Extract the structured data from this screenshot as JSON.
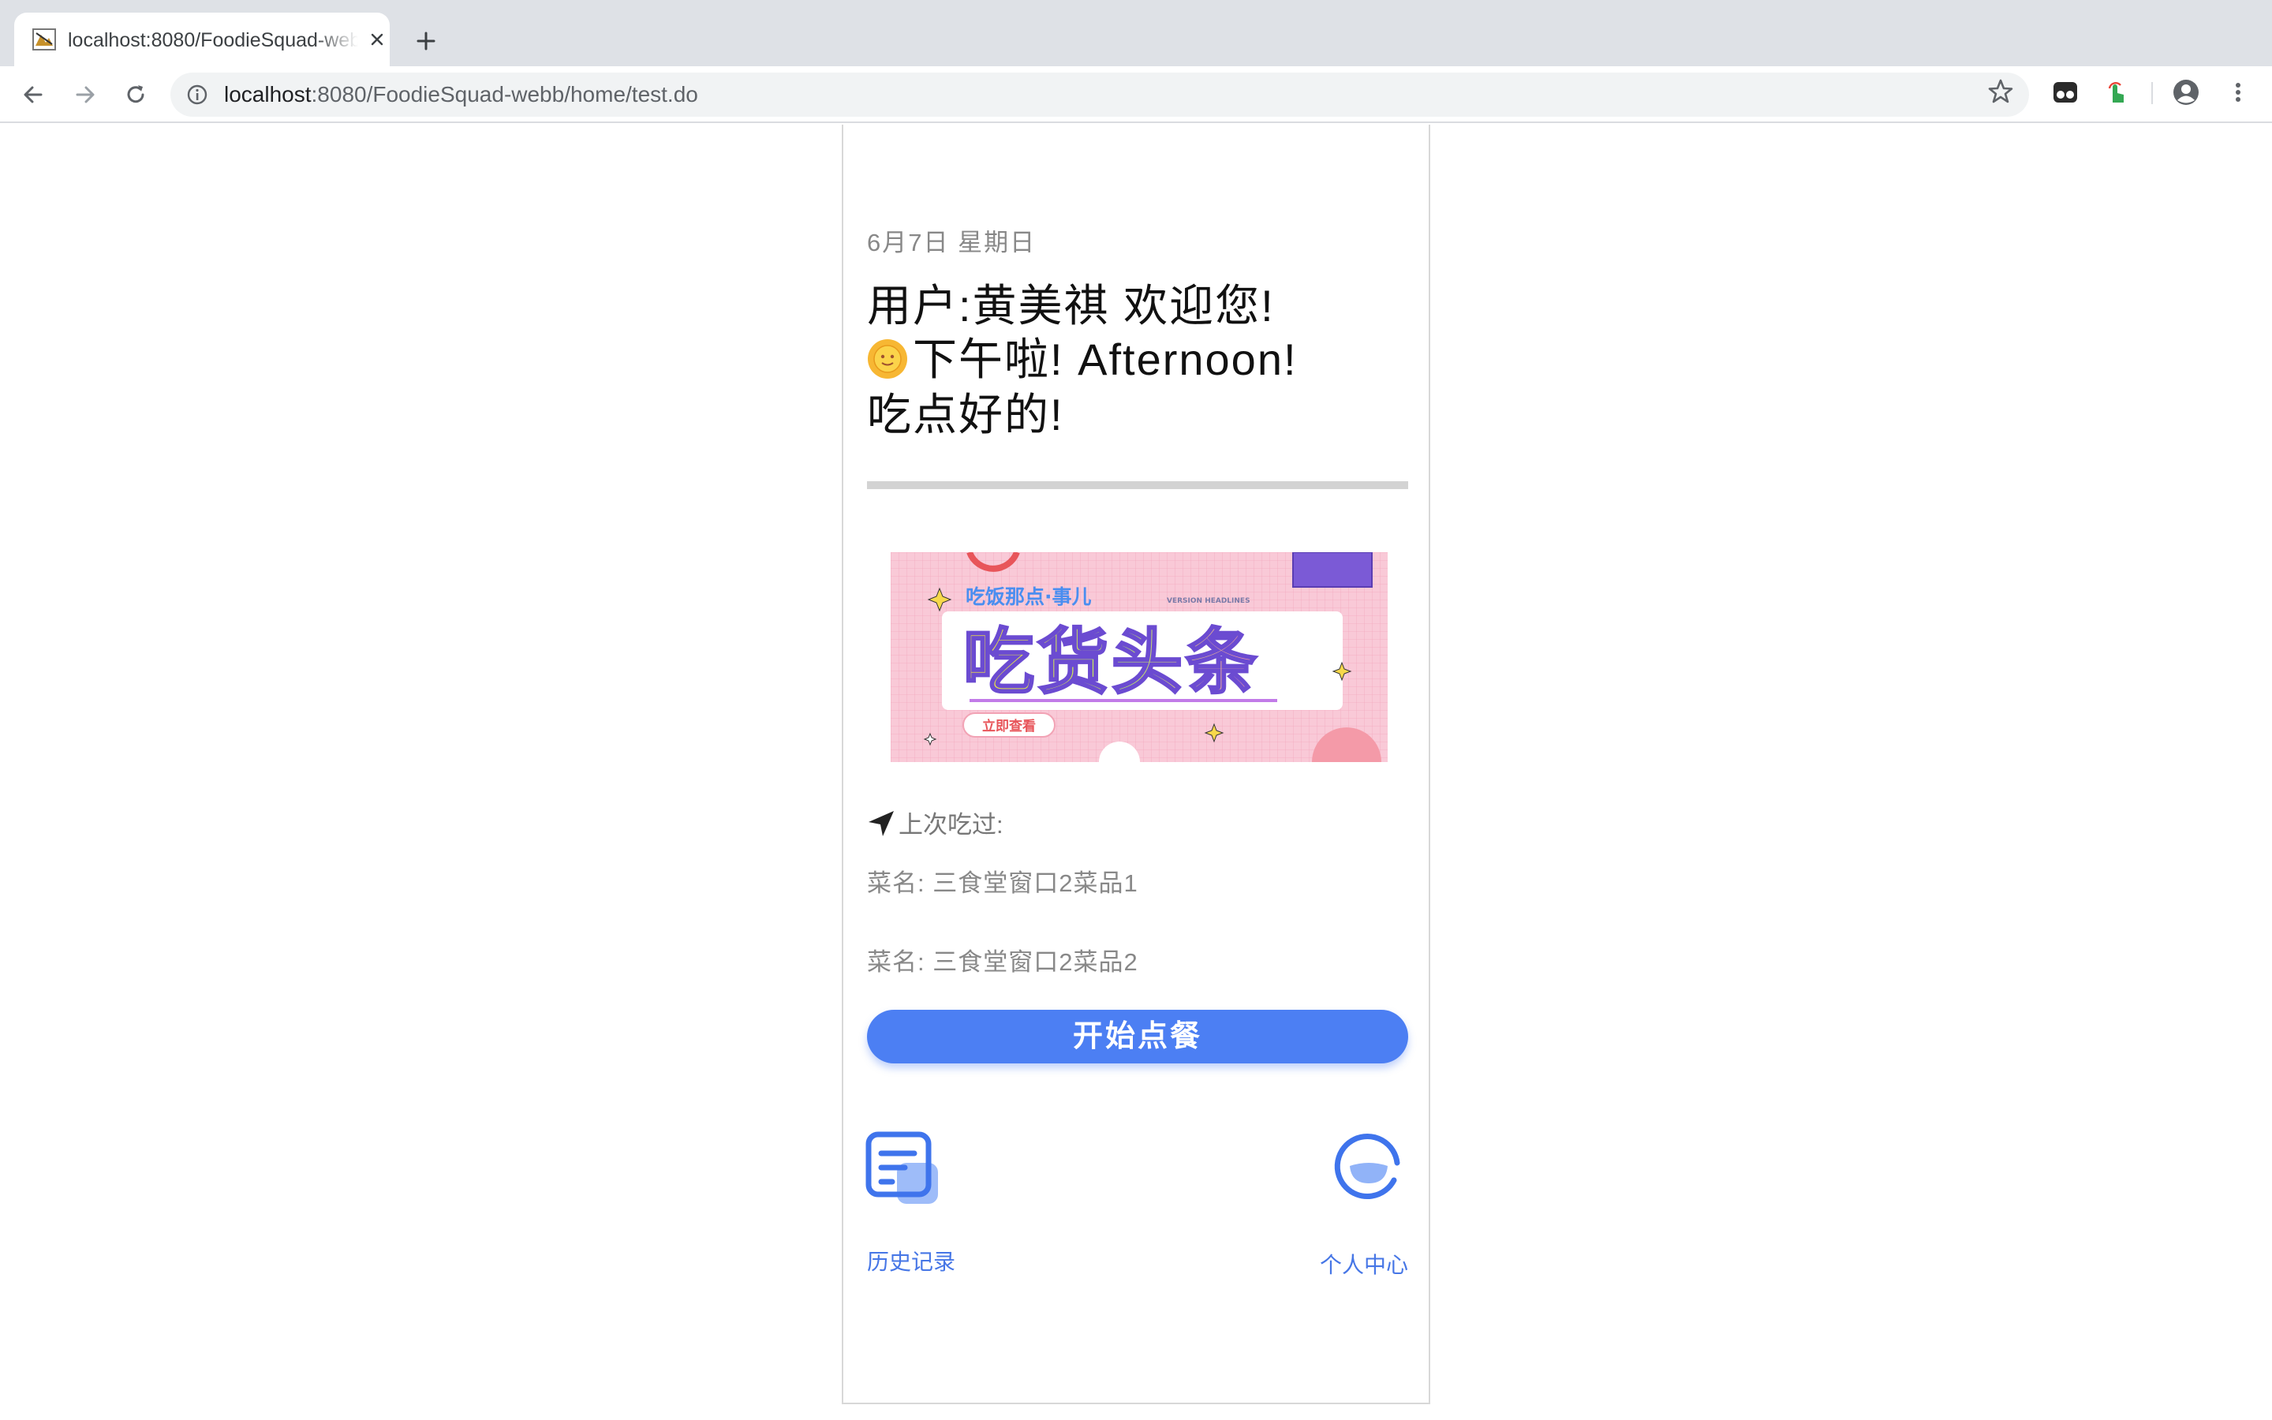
{
  "browser": {
    "tab_title": "localhost:8080/FoodieSquad-webb/home/test.do",
    "url_host": "localhost",
    "url_rest": ":8080/FoodieSquad-webb/home/test.do",
    "icons": [
      "favicon-icon",
      "close-icon",
      "plus-icon",
      "back-icon",
      "forward-icon",
      "reload-icon",
      "info-icon",
      "star-icon",
      "extension-icon",
      "touch-extension-icon",
      "account-icon",
      "menu-icon"
    ]
  },
  "page": {
    "date": "6月7日  星期日",
    "greeting_line1": "用户:黄美祺    欢迎您!",
    "greeting_line2": "下午啦!     Afternoon!",
    "greeting_line3": "吃点好的!",
    "banner": {
      "top_text": "吃饭那点·事儿",
      "sub_text": "VERSION  HEADLINES",
      "headline": "吃货头条",
      "button": "立即查看"
    },
    "last_ate_label": "上次吃过:",
    "dishes": [
      "菜名:  三食堂窗口2菜品1",
      "菜名:  三食堂窗口2菜品2"
    ],
    "order_button": "开始点餐",
    "history_label": "历史记录",
    "profile_label": "个人中心"
  },
  "colors": {
    "primary_blue": "#4c7ff3",
    "link_blue": "#4676e6",
    "banner_pink": "#f9c9d7"
  }
}
